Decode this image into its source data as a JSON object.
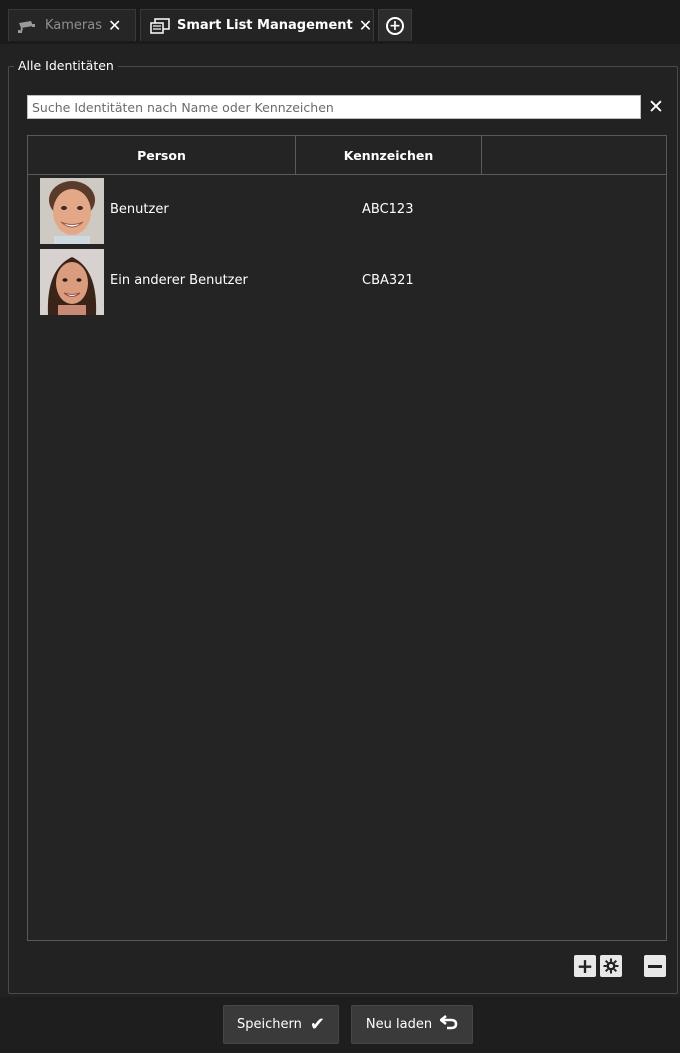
{
  "tabs": [
    {
      "label": "Kameras",
      "icon": "camera-icon",
      "active": false
    },
    {
      "label": "Smart List Management",
      "icon": "list-management-icon",
      "active": true
    }
  ],
  "group": {
    "legend": "Alle Identitäten"
  },
  "search": {
    "placeholder": "Suche Identitäten nach Name oder Kennzeichen"
  },
  "table": {
    "columns": [
      "Person",
      "Kennzeichen",
      ""
    ],
    "rows": [
      {
        "name": "Benutzer",
        "plate": "ABC123"
      },
      {
        "name": "Ein anderer Benutzer",
        "plate": "CBA321"
      }
    ]
  },
  "footer": {
    "save_label": "Speichern",
    "reload_label": "Neu laden"
  },
  "colors": {
    "background": "#222222",
    "panel": "#242424",
    "border": "#5a5a5a",
    "text": "#ffffff",
    "button": "#3a3a3a"
  }
}
